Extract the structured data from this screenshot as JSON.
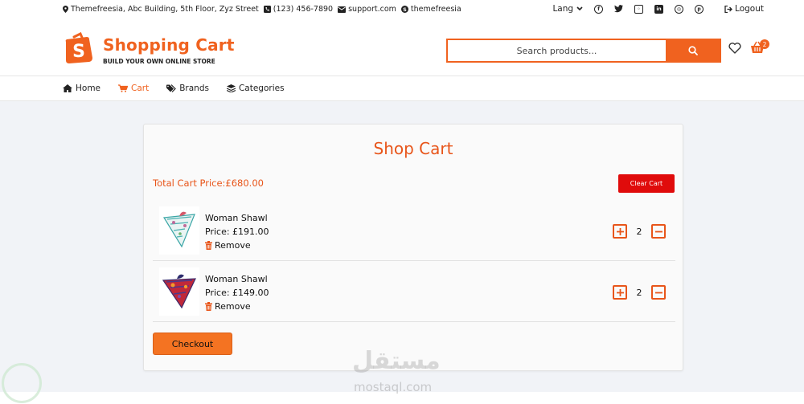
{
  "topbar": {
    "address": "Themefreesia, Abc Building, 5th Floor, Zyz Street",
    "phone": "(123) 456-7890",
    "email": "support.com",
    "skype": "themefreesia",
    "lang_label": "Lang",
    "logout_label": "Logout",
    "social_icons": [
      "facebook-icon",
      "twitter-icon",
      "instagram-icon",
      "linkedin-icon",
      "dribbble-icon",
      "pinterest-icon"
    ]
  },
  "header": {
    "logo_letter": "S",
    "brand_title": "Shopping Cart",
    "brand_subtitle": "BUILD YOUR OWN ONLINE STORE",
    "search_placeholder": "Search products...",
    "cart_count": "2",
    "accent_color": "#f0621f"
  },
  "nav": {
    "items": [
      {
        "label": "Home",
        "icon": "home-icon",
        "active": false
      },
      {
        "label": "Cart",
        "icon": "cart-icon",
        "active": true
      },
      {
        "label": "Brands",
        "icon": "tags-icon",
        "active": false
      },
      {
        "label": "Categories",
        "icon": "layers-icon",
        "active": false
      }
    ]
  },
  "cart": {
    "title": "Shop Cart",
    "total_label": "Total Cart Price:£680.00",
    "clear_label": "Clear Cart",
    "checkout_label": "Checkout",
    "remove_label": "Remove",
    "items": [
      {
        "name": "Woman Shawl",
        "price": "Price: £191.00",
        "qty": "2",
        "image": "shawl-white-icon"
      },
      {
        "name": "Woman Shawl",
        "price": "Price: £149.00",
        "qty": "2",
        "image": "shawl-red-icon"
      }
    ]
  },
  "watermark": {
    "arabic": "مستقل",
    "domain": "mostaql.com"
  }
}
